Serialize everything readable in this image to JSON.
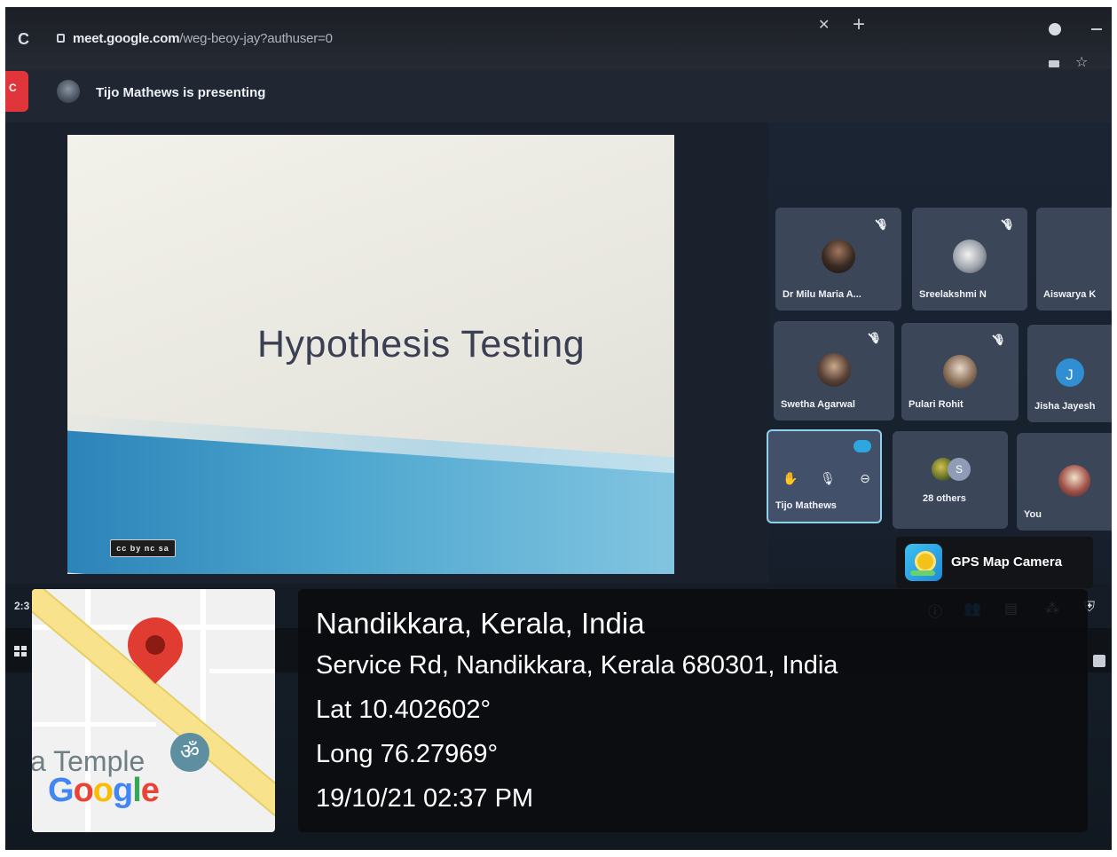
{
  "browser": {
    "url_domain": "meet.google.com",
    "url_path": "/weg-beoy-jay?authuser=0"
  },
  "meet": {
    "presenter_text": "Tijo Mathews is presenting",
    "call_time": "2:3"
  },
  "slide": {
    "title": "Hypothesis Testing",
    "license_badge": "cc by nc sa"
  },
  "participants": [
    {
      "name": "Dr Milu Maria A...",
      "muted": true
    },
    {
      "name": "Sreelakshmi N",
      "muted": true
    },
    {
      "name": "Aiswarya K",
      "muted": false
    },
    {
      "name": "Swetha Agarwal",
      "muted": true
    },
    {
      "name": "Pulari Rohit",
      "muted": true
    },
    {
      "name": "Jisha Jayesh",
      "muted": false,
      "initial": "J"
    },
    {
      "name": "Tijo Mathews",
      "speaking": true
    },
    {
      "name": "28 others",
      "initial": "S"
    },
    {
      "name": "You"
    }
  ],
  "gps_overlay": {
    "brand": "GPS Map Camera",
    "place": "Nandikkara, Kerala, India",
    "address": "Service Rd, Nandikkara, Kerala 680301, India",
    "lat": "Lat 10.402602°",
    "long": "Long 76.27969°",
    "datetime": "19/10/21 02:37 PM"
  },
  "map": {
    "label": "a Temple",
    "attribution": "Google",
    "poi_icon": "om-icon"
  },
  "colors": {
    "slide_bg": "#efeee6",
    "slide_title": "#3a3f54",
    "tile_bg": "#3b4658",
    "active_tile_border": "#8fd0ea",
    "map_pin": "#e03c32",
    "overlay_bg": "#0a0b0e"
  }
}
